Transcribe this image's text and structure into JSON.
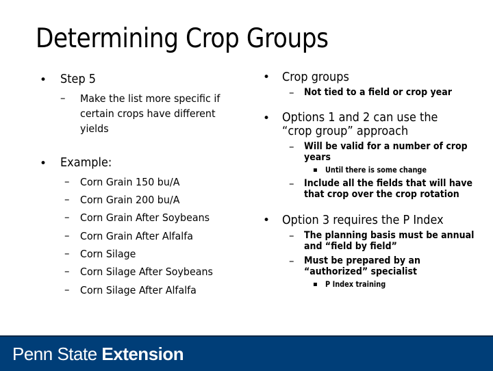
{
  "slide": {
    "title": "Determining Crop Groups"
  },
  "left": {
    "step": {
      "label": "Step 5",
      "sub": [
        "Make the list more specific if",
        "certain crops have different",
        "yields"
      ]
    },
    "example": {
      "label": "Example:",
      "items": [
        "Corn Grain 150 bu/A",
        "Corn Grain 200 bu/A",
        "Corn Grain After Soybeans",
        "Corn Grain After Alfalfa",
        "Corn Silage",
        "Corn Silage After Soybeans",
        "Corn Silage After Alfalfa"
      ]
    }
  },
  "right": {
    "crop_groups": {
      "label": "Crop groups",
      "sub": "Not tied to a field or crop year"
    },
    "options12": {
      "label_lines": [
        "Options 1 and 2 can use the",
        "“crop group” approach"
      ],
      "sub1_lines": [
        "Will be valid for a number of crop",
        "years"
      ],
      "sub1_child": "Until there is some change",
      "sub2_lines": [
        "Include all the fields that will have",
        "that crop over the crop rotation"
      ]
    },
    "option3": {
      "label": "Option 3 requires the P Index",
      "sub1_lines": [
        "The planning basis must be annual",
        "and “field by field”"
      ],
      "sub2_lines": [
        "Must be prepared by an",
        "“authorized” specialist"
      ],
      "sub2_child": "P Index training"
    }
  },
  "footer": {
    "brand_regular": "Penn State ",
    "brand_bold": "Extension",
    "color": "#003E78"
  },
  "glyphs": {
    "bullet": "•",
    "dash": "–",
    "square": "▪"
  }
}
